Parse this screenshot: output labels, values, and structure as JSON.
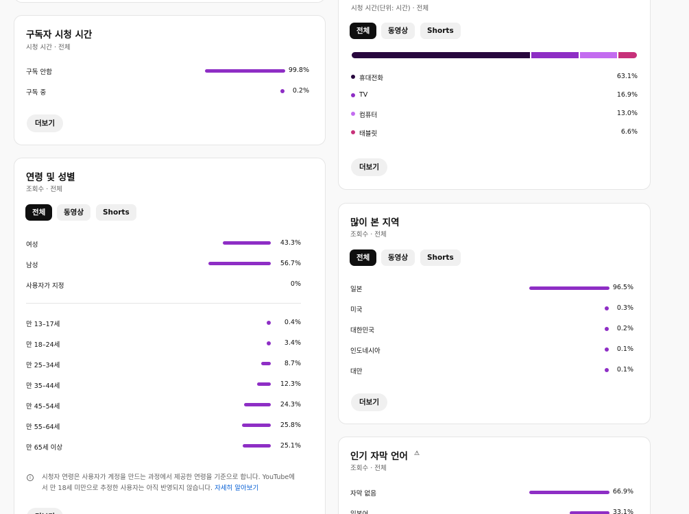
{
  "subscriber_card": {
    "title": "구독자 시청 시간",
    "subtitle": "시청 시간 · 전체",
    "rows": [
      {
        "label": "구독 안함",
        "value": "99.8%",
        "pct": 99.8
      },
      {
        "label": "구독 중",
        "value": "0.2%",
        "pct": 0.2
      }
    ],
    "more_label": "더보기"
  },
  "age_gender_card": {
    "title": "연령 및 성별",
    "subtitle": "조회수 · 전체",
    "tabs": [
      "전체",
      "동영상",
      "Shorts"
    ],
    "gender_rows": [
      {
        "label": "여성",
        "value": "43.3%",
        "pct": 43.3
      },
      {
        "label": "남성",
        "value": "56.7%",
        "pct": 56.7
      },
      {
        "label": "사용자가 지정",
        "value": "0%",
        "pct": 0
      }
    ],
    "age_rows": [
      {
        "label": "만 13–17세",
        "value": "0.4%",
        "pct": 0.4
      },
      {
        "label": "만 18–24세",
        "value": "3.4%",
        "pct": 3.4
      },
      {
        "label": "만 25–34세",
        "value": "8.7%",
        "pct": 8.7
      },
      {
        "label": "만 35–44세",
        "value": "12.3%",
        "pct": 12.3
      },
      {
        "label": "만 45–54세",
        "value": "24.3%",
        "pct": 24.3
      },
      {
        "label": "만 55–64세",
        "value": "25.8%",
        "pct": 25.8
      },
      {
        "label": "만 65세 이상",
        "value": "25.1%",
        "pct": 25.1
      }
    ],
    "info_line1": "시청자 연령은 사용자가 계정을 만드는 과정에서 제공한 연령을 기준으로 합니다. YouTube에",
    "info_line2": "서 만 18세 미만으로 추정한 사용자는 아직 반영되지 않습니다.",
    "info_link": "자세히 알아보기",
    "more_label": "더보기"
  },
  "device_card": {
    "subtitle": "시청 시간(단위: 시간) · 전체",
    "tabs": [
      "전체",
      "동영상",
      "Shorts"
    ],
    "rows": [
      {
        "label": "휴대전화",
        "value": "63.1%",
        "pct": 63.1,
        "color": "#28073e"
      },
      {
        "label": "TV",
        "value": "16.9%",
        "pct": 16.9,
        "color": "#8e2ec5"
      },
      {
        "label": "컴퓨터",
        "value": "13.0%",
        "pct": 13.0,
        "color": "#c36cf0"
      },
      {
        "label": "태블릿",
        "value": "6.6%",
        "pct": 6.6,
        "color": "#c7317a"
      }
    ],
    "more_label": "더보기"
  },
  "geo_card": {
    "title": "많이 본 지역",
    "subtitle": "조회수 · 전체",
    "tabs": [
      "전체",
      "동영상",
      "Shorts"
    ],
    "rows": [
      {
        "label": "일본",
        "value": "96.5%",
        "pct": 96.5
      },
      {
        "label": "미국",
        "value": "0.3%",
        "pct": 0.3
      },
      {
        "label": "대한민국",
        "value": "0.2%",
        "pct": 0.2
      },
      {
        "label": "인도네시아",
        "value": "0.1%",
        "pct": 0.1
      },
      {
        "label": "대만",
        "value": "0.1%",
        "pct": 0.1
      }
    ],
    "more_label": "더보기"
  },
  "subtitle_card": {
    "title": "인기 자막 언어",
    "subtitle": "조회수 · 전체",
    "rows": [
      {
        "label": "자막 없음",
        "value": "66.9%",
        "pct": 66.9
      },
      {
        "label": "일본어",
        "value": "33.1%",
        "pct": 33.1
      }
    ]
  },
  "colors": {
    "bar": "#8e2ec5",
    "chip_active_bg": "#0f0f0f",
    "link": "#065fd4"
  }
}
